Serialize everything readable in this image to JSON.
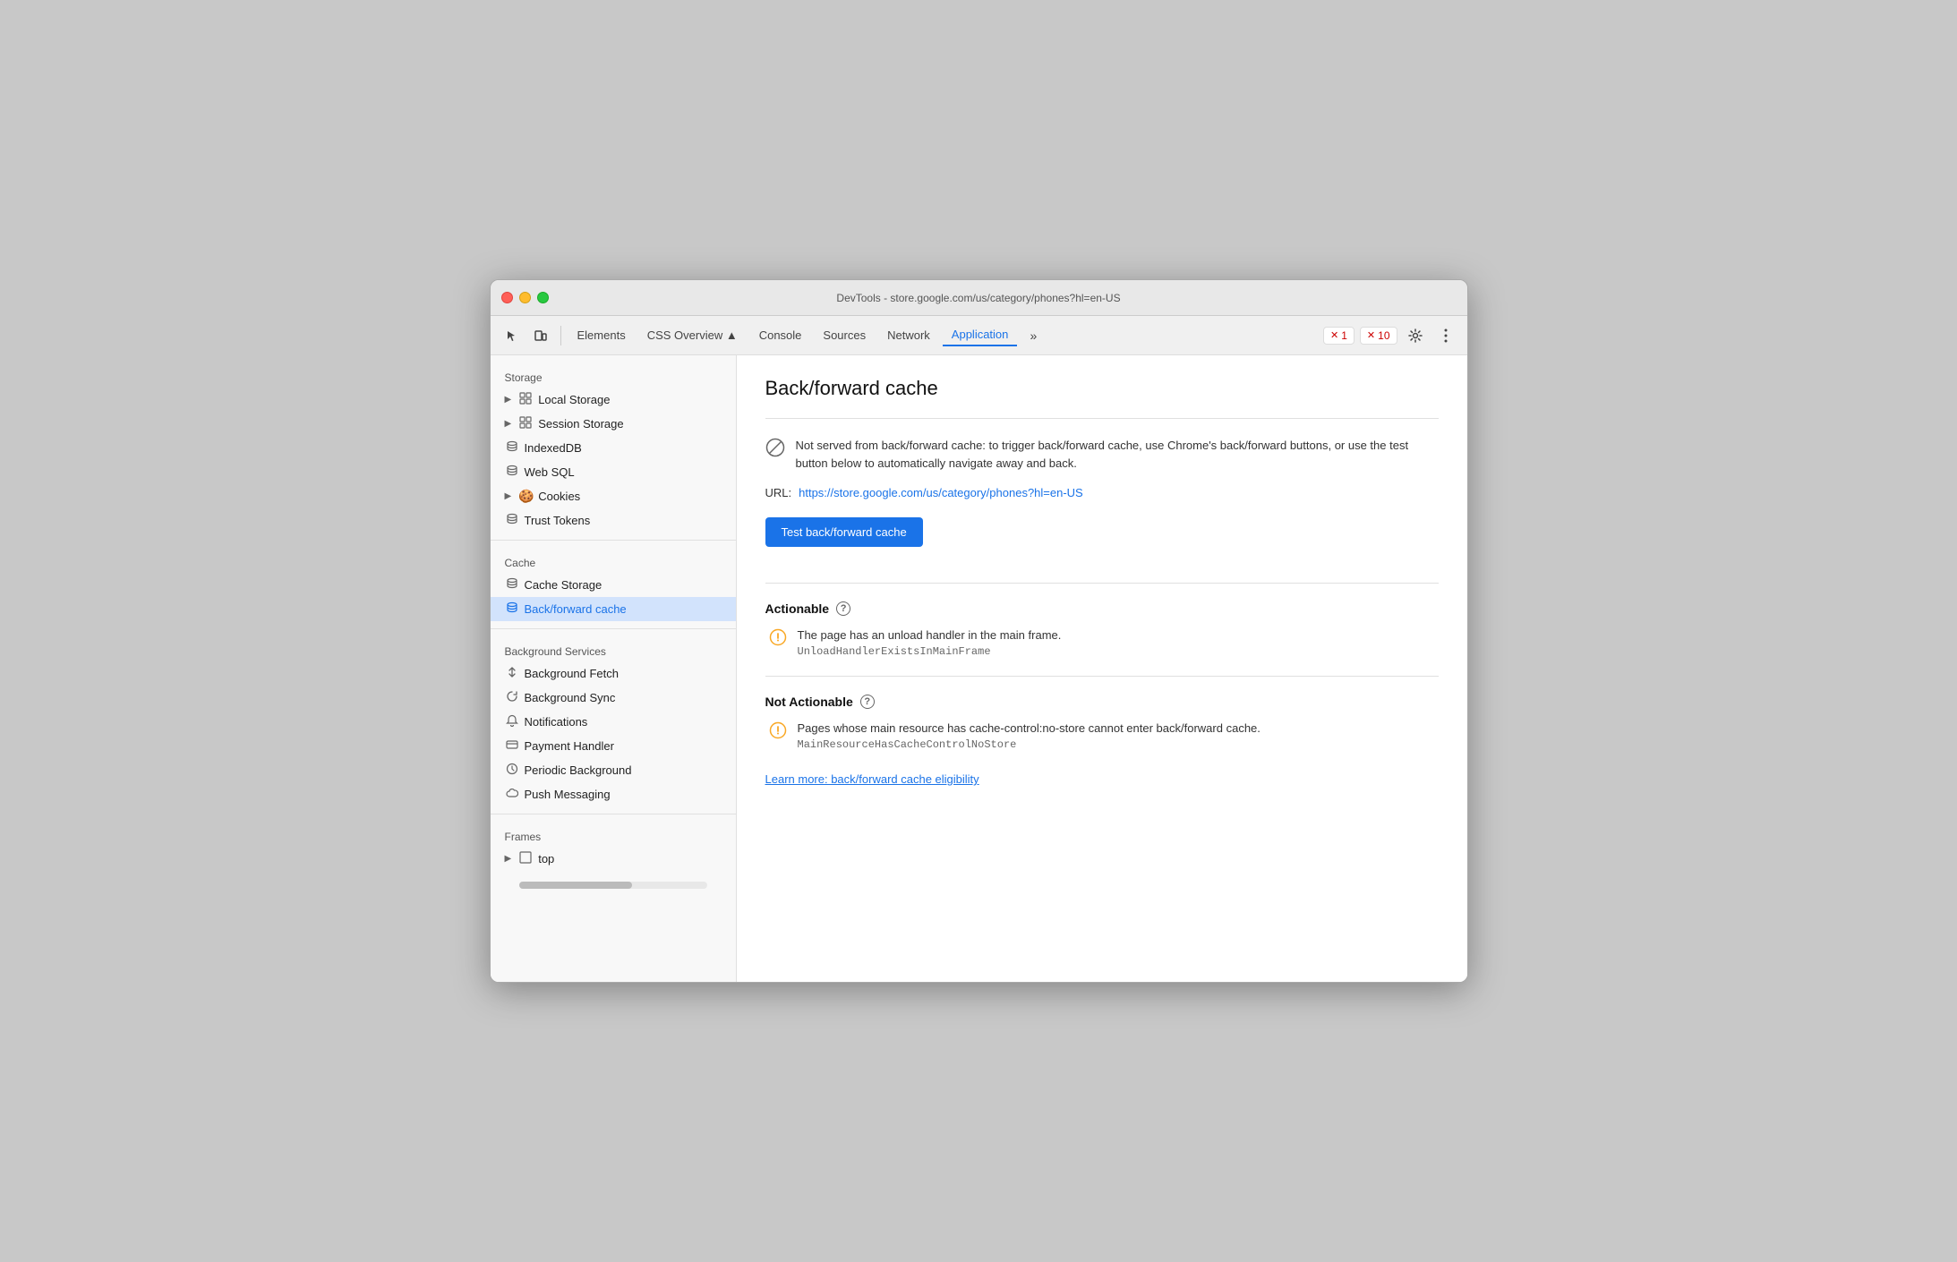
{
  "window": {
    "title": "DevTools - store.google.com/us/category/phones?hl=en-US"
  },
  "toolbar": {
    "tabs": [
      {
        "id": "elements",
        "label": "Elements",
        "active": false
      },
      {
        "id": "css-overview",
        "label": "CSS Overview ▲",
        "active": false
      },
      {
        "id": "console",
        "label": "Console",
        "active": false
      },
      {
        "id": "sources",
        "label": "Sources",
        "active": false
      },
      {
        "id": "network",
        "label": "Network",
        "active": false
      },
      {
        "id": "application",
        "label": "Application",
        "active": true
      }
    ],
    "more_tabs": "»",
    "errors": {
      "count1": "1",
      "count2": "10"
    }
  },
  "sidebar": {
    "storage_section": "Storage",
    "items": [
      {
        "id": "local-storage",
        "label": "Local Storage",
        "icon": "grid",
        "hasArrow": true
      },
      {
        "id": "session-storage",
        "label": "Session Storage",
        "icon": "grid",
        "hasArrow": true
      },
      {
        "id": "indexeddb",
        "label": "IndexedDB",
        "icon": "db",
        "hasArrow": false
      },
      {
        "id": "web-sql",
        "label": "Web SQL",
        "icon": "db",
        "hasArrow": false
      },
      {
        "id": "cookies",
        "label": "Cookies",
        "icon": "cookie",
        "hasArrow": true
      },
      {
        "id": "trust-tokens",
        "label": "Trust Tokens",
        "icon": "db",
        "hasArrow": false
      }
    ],
    "cache_section": "Cache",
    "cache_items": [
      {
        "id": "cache-storage",
        "label": "Cache Storage",
        "icon": "db",
        "hasArrow": false
      },
      {
        "id": "backforward-cache",
        "label": "Back/forward cache",
        "icon": "db",
        "hasArrow": false,
        "active": true
      }
    ],
    "bg_section": "Background Services",
    "bg_items": [
      {
        "id": "bg-fetch",
        "label": "Background Fetch",
        "icon": "arrows"
      },
      {
        "id": "bg-sync",
        "label": "Background Sync",
        "icon": "sync"
      },
      {
        "id": "notifications",
        "label": "Notifications",
        "icon": "bell"
      },
      {
        "id": "payment-handler",
        "label": "Payment Handler",
        "icon": "payment"
      },
      {
        "id": "periodic-bg",
        "label": "Periodic Background",
        "icon": "clock"
      },
      {
        "id": "push-messaging",
        "label": "Push Messaging",
        "icon": "cloud"
      }
    ],
    "frames_section": "Frames",
    "frames_items": [
      {
        "id": "top-frame",
        "label": "top",
        "icon": "frame",
        "hasArrow": true
      }
    ]
  },
  "main": {
    "title": "Back/forward cache",
    "info_message": "Not served from back/forward cache: to trigger back/forward cache, use Chrome's back/forward buttons, or use the test button below to automatically navigate away and back.",
    "url_label": "URL:",
    "url_value": "https://store.google.com/us/category/phones?hl=en-US",
    "test_button": "Test back/forward cache",
    "actionable_section": "Actionable",
    "actionable_issue": "The page has an unload handler in the main frame.",
    "actionable_code": "UnloadHandlerExistsInMainFrame",
    "not_actionable_section": "Not Actionable",
    "not_actionable_issue": "Pages whose main resource has cache-control:no-store cannot enter back/forward cache.",
    "not_actionable_code": "MainResourceHasCacheControlNoStore",
    "learn_more": "Learn more: back/forward cache eligibility"
  }
}
